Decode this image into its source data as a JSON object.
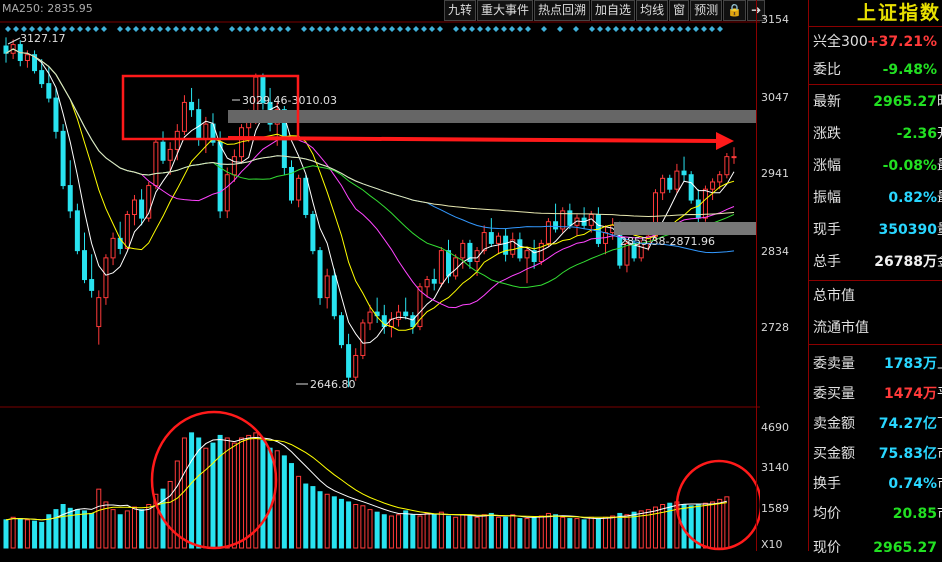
{
  "ma250": {
    "label": "MA250:",
    "value": "2835.95"
  },
  "toolbar": {
    "items": [
      "九转",
      "重大事件",
      "热点回溯",
      "加自选",
      "均线",
      "窗",
      "预测",
      "🔒",
      "➔"
    ]
  },
  "price_axis": {
    "labels": [
      "3154",
      "3047",
      "2941",
      "2834",
      "2728"
    ]
  },
  "volume_axis": {
    "labels": [
      "4690",
      "3140",
      "1589",
      "X10"
    ]
  },
  "annotations": {
    "high": "3127.17",
    "gap_top": "3029.46-3010.03",
    "gap_bottom": "2855.38-2871.96",
    "low": "2646.80"
  },
  "panel": {
    "title": "上证指数",
    "rows": [
      {
        "k": "兴全300",
        "v": "+37.21%",
        "c": "red",
        "t": ""
      },
      {
        "k": "委比",
        "v": "-9.48%",
        "c": "green",
        "t": ""
      },
      {
        "k": "最新",
        "v": "2965.27",
        "c": "green",
        "t": "昨"
      },
      {
        "k": "涨跌",
        "v": "-2.36",
        "c": "green",
        "t": "开"
      },
      {
        "k": "涨幅",
        "v": "-0.08%",
        "c": "green",
        "t": "最"
      },
      {
        "k": "振幅",
        "v": "0.82%",
        "c": "cyan",
        "t": "最"
      },
      {
        "k": "现手",
        "v": "350390",
        "c": "cyan",
        "t": "量"
      },
      {
        "k": "总手",
        "v": "26788万",
        "c": "white",
        "t": "金"
      },
      {
        "k": "总市值",
        "v": "",
        "c": "white",
        "t": ""
      },
      {
        "k": "流通市值",
        "v": "",
        "c": "white",
        "t": ""
      },
      {
        "k": "委卖量",
        "v": "1783万",
        "c": "cyan",
        "t": "上"
      },
      {
        "k": "委买量",
        "v": "1474万",
        "c": "red",
        "t": "平"
      },
      {
        "k": "卖金额",
        "v": "74.27亿",
        "c": "cyan",
        "t": "下"
      },
      {
        "k": "买金额",
        "v": "75.83亿",
        "c": "cyan",
        "t": "市"
      },
      {
        "k": "换手",
        "v": "0.74%",
        "c": "cyan",
        "t": "市"
      },
      {
        "k": "均价",
        "v": "20.85",
        "c": "green",
        "t": "市"
      },
      {
        "k": "现价",
        "v": "2965.27",
        "c": "green",
        "t": ""
      }
    ]
  },
  "colors": {
    "up": "#ff3a3a",
    "down": "#29e3f0",
    "annotation": "#ff1a1a"
  }
}
